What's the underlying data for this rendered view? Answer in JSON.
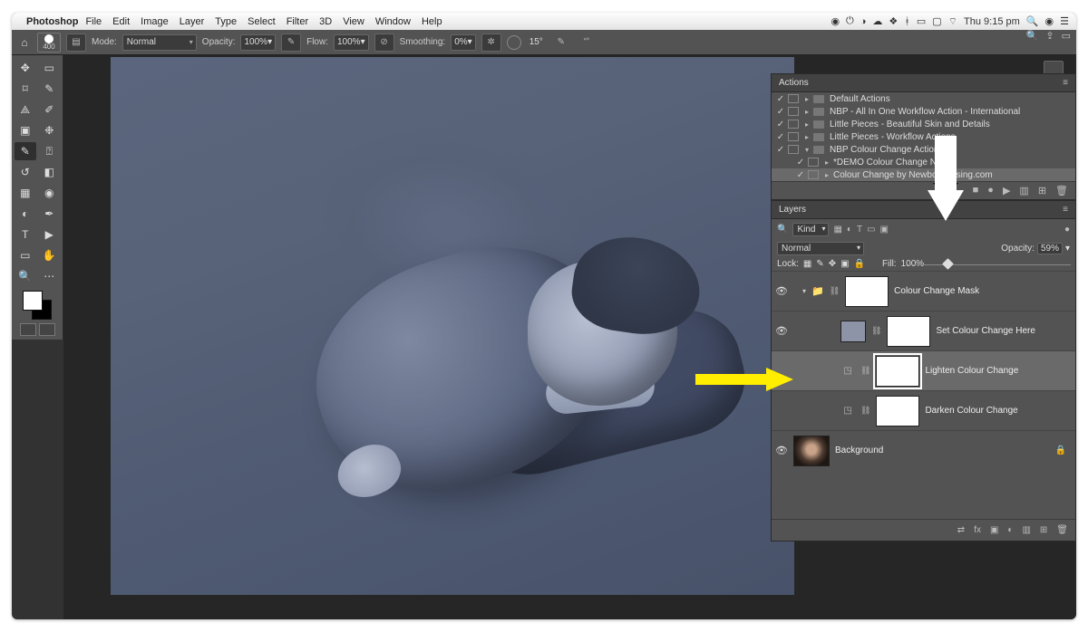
{
  "menubar": {
    "app": "Photoshop",
    "items": [
      "File",
      "Edit",
      "Image",
      "Layer",
      "Type",
      "Select",
      "Filter",
      "3D",
      "View",
      "Window",
      "Help"
    ],
    "clock": "Thu 9:15 pm"
  },
  "optionsBar": {
    "brushSize": "400",
    "modeLabel": "Mode:",
    "mode": "Normal",
    "opacityLabel": "Opacity:",
    "opacity": "100%",
    "flowLabel": "Flow:",
    "flow": "100%",
    "smoothingLabel": "Smoothing:",
    "smoothing": "0%",
    "angle": "15°"
  },
  "actionsPanel": {
    "title": "Actions",
    "rows": [
      {
        "indent": 0,
        "folder": true,
        "label": "Default Actions"
      },
      {
        "indent": 0,
        "folder": true,
        "label": "NBP - All In One Workflow Action - International"
      },
      {
        "indent": 0,
        "folder": true,
        "label": "Little Pieces - Beautiful Skin and Details"
      },
      {
        "indent": 0,
        "folder": true,
        "label": "Little Pieces - Workflow Actions"
      },
      {
        "indent": 0,
        "folder": true,
        "open": true,
        "label": "NBP Colour Change Action"
      },
      {
        "indent": 1,
        "folder": false,
        "label": "*DEMO Colour Change NBP"
      },
      {
        "indent": 1,
        "folder": false,
        "selected": true,
        "label": "Colour Change by NewbornPosing.com"
      }
    ]
  },
  "layersPanel": {
    "title": "Layers",
    "kind": "Kind",
    "blend": "Normal",
    "opacityLabel": "Opacity:",
    "opacity": "59%",
    "lockLabel": "Lock:",
    "fillLabel": "Fill:",
    "fill": "100%",
    "layers": [
      {
        "type": "group",
        "name": "Colour Change Mask",
        "eye": true
      },
      {
        "type": "solid",
        "name": "Set Colour Change Here",
        "eye": true
      },
      {
        "type": "curves",
        "name": "Lighten Colour Change",
        "eye": false,
        "selected": true
      },
      {
        "type": "curves",
        "name": "Darken Colour Change",
        "eye": false
      },
      {
        "type": "bg",
        "name": "Background",
        "eye": true,
        "locked": true
      }
    ]
  }
}
